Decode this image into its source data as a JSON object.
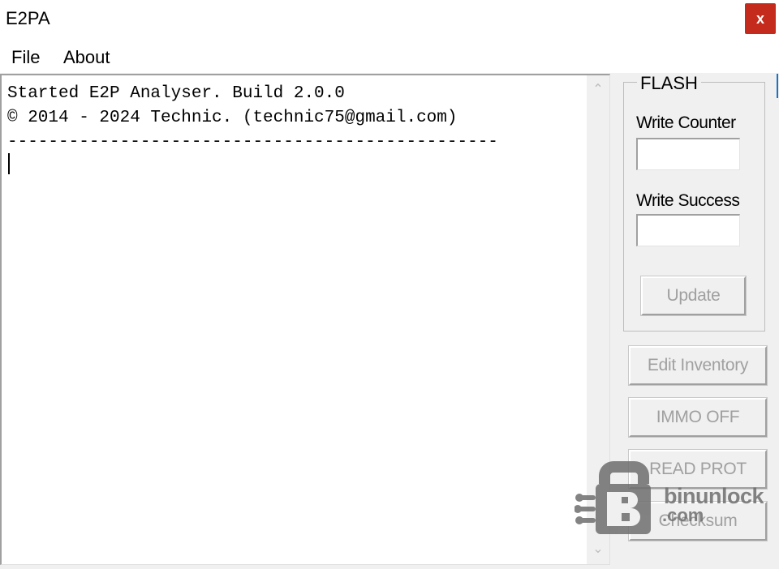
{
  "window": {
    "title": "E2PA",
    "close_label": "x"
  },
  "menu": {
    "items": [
      {
        "label": "File"
      },
      {
        "label": "About"
      }
    ]
  },
  "log": {
    "lines": [
      "Started E2P Analyser. Build 2.0.0",
      "© 2014 - 2024 Technic. (technic75@gmail.com)",
      "------------------------------------------------"
    ]
  },
  "flash": {
    "title": "FLASH",
    "write_counter_label": "Write Counter",
    "write_counter_value": "",
    "write_success_label": "Write Success",
    "write_success_value": "",
    "update_label": "Update"
  },
  "buttons": {
    "edit_inventory": "Edit Inventory",
    "immo_off": "IMMO OFF",
    "read_prot": "READ PROT",
    "checksum": "Checksum"
  },
  "watermark": {
    "line1": "binunlock",
    "line2": ".com"
  },
  "colors": {
    "close_bg": "#c42b1c",
    "disabled_text": "#a0a0a0",
    "background": "#f0f0f0"
  }
}
